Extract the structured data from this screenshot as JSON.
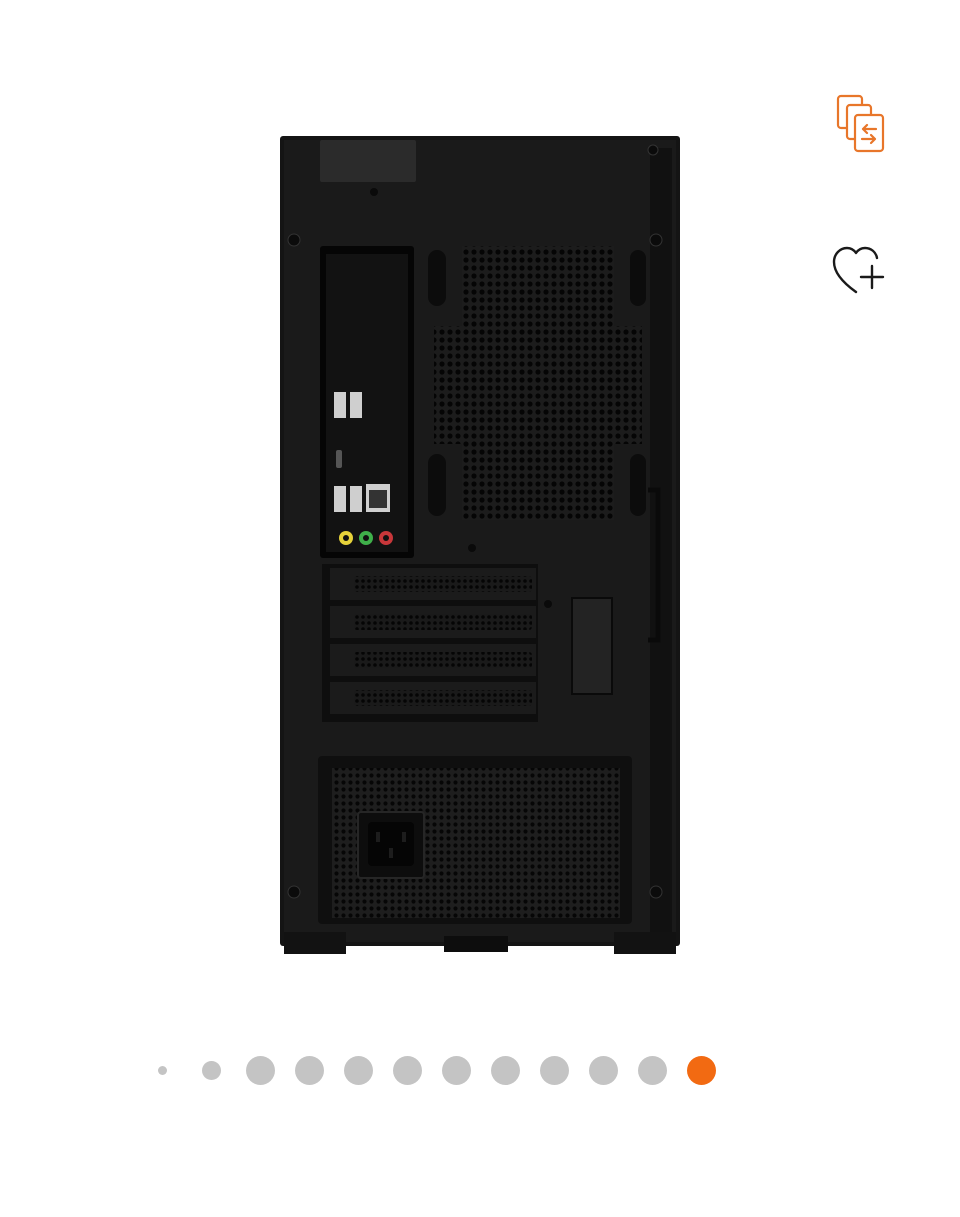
{
  "gallery": {
    "image_name": "desktop-tower-rear-view",
    "actions": {
      "compare_icon": "compare-icon",
      "wishlist_icon": "heart-plus-icon",
      "accent_color": "#e8762a"
    },
    "pagination": {
      "total": 12,
      "active_index": 11,
      "active_color": "#f26a12",
      "inactive_color": "#c4c4c4"
    }
  }
}
